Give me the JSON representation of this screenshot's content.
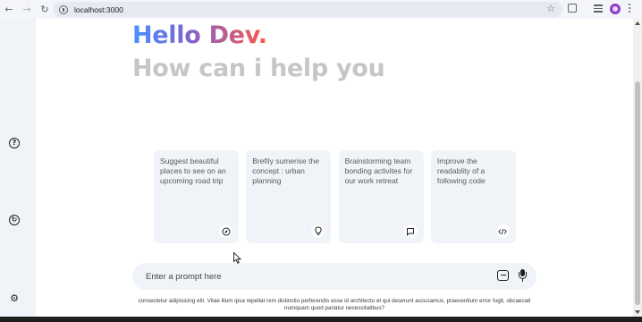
{
  "browser": {
    "url": "localhost:3000",
    "icons": [
      "back-arrow-icon",
      "forward-arrow-icon",
      "reload-icon",
      "site-info-icon",
      "bookmark-star-icon",
      "extensions-icon",
      "media-controls-icon",
      "profile-avatar",
      "menu-dots-icon"
    ]
  },
  "sidebar": {
    "icons": [
      "help-icon",
      "history-icon",
      "settings-icon"
    ]
  },
  "greeting": {
    "hello": "Hello Dev.",
    "subtitle": "How can i help you"
  },
  "cards": [
    {
      "text": "Suggest beautiful places to see on an upcoming road trip",
      "icon": "compass-icon"
    },
    {
      "text": "Brefily sumerise the concept : urban planning",
      "icon": "bulb-icon"
    },
    {
      "text": "Brainstorming team bonding activites for our work retreat",
      "icon": "message-icon"
    },
    {
      "text": "Improve the readablity of a following code",
      "icon": "code-icon"
    }
  ],
  "prompt": {
    "placeholder": "Enter a prompt here",
    "value": ""
  },
  "disclaimer": "consectetur adipisicing elit. Vitae illum ipsa repellat rem distinctio perferendis esse id architecto et qui deserunt accusamus, praesentium error fugit, obcaecati numquam quod pariatur necessitatibus?",
  "colors": {
    "gradient_start": "#4b90ff",
    "gradient_end": "#ff5546",
    "subtitle": "#c4c7c5",
    "card_bg": "#f0f4f9",
    "sidebar_bg": "#f0f4f9"
  }
}
